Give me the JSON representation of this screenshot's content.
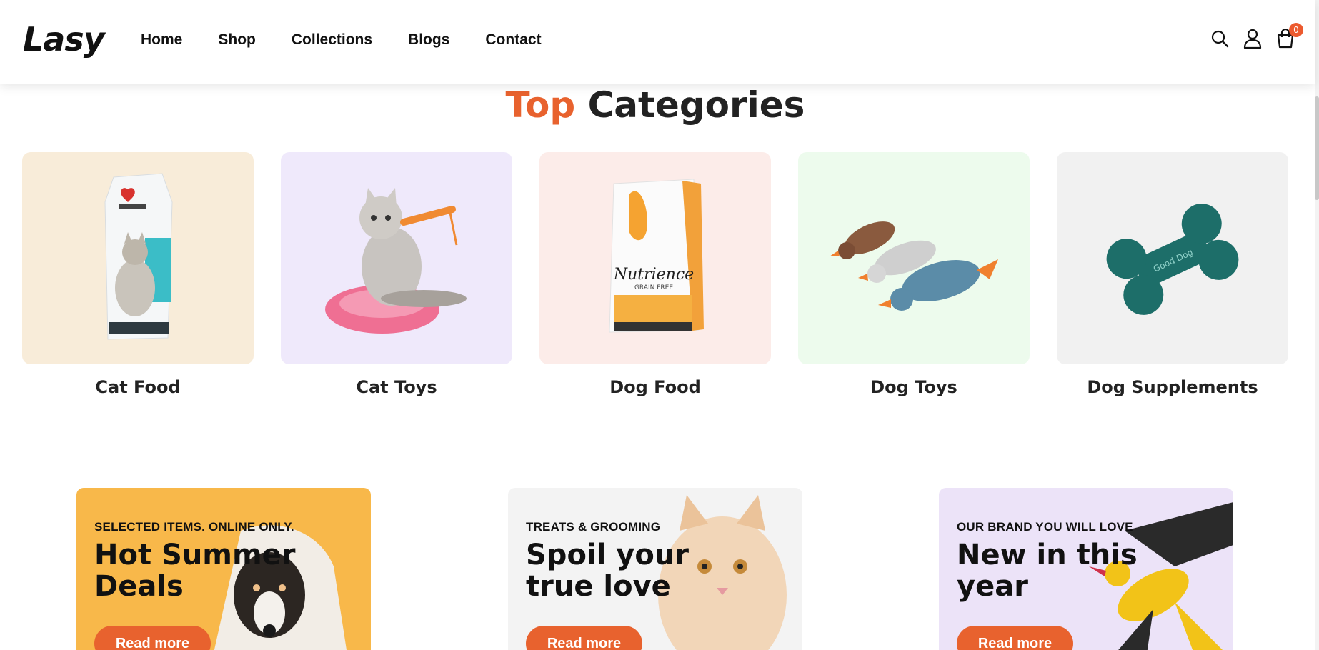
{
  "header": {
    "logo": "Lasy",
    "nav": [
      "Home",
      "Shop",
      "Collections",
      "Blogs",
      "Contact"
    ],
    "cart_count": "0",
    "icons": [
      "search-icon",
      "user-icon",
      "cart-icon"
    ]
  },
  "section": {
    "title_accent": "Top",
    "title_rest": "Categories"
  },
  "categories": [
    {
      "label": "Cat Food",
      "bg": "#f8ecd9"
    },
    {
      "label": "Cat Toys",
      "bg": "#efe9fb"
    },
    {
      "label": "Dog Food",
      "bg": "#fcece9"
    },
    {
      "label": "Dog Toys",
      "bg": "#edfbed"
    },
    {
      "label": "Dog Supplements",
      "bg": "#f1f1f1"
    }
  ],
  "promos": [
    {
      "eyebrow": "SELECTED ITEMS. ONLINE ONLY.",
      "headline": "Hot Summer Deals",
      "button": "Read more",
      "bg": "#f8b84a"
    },
    {
      "eyebrow": "TREATS & GROOMING",
      "headline": "Spoil your true love",
      "button": "Read more",
      "bg": "#f3f3f3"
    },
    {
      "eyebrow": "OUR BRAND YOU WILL LOVE",
      "headline": "New in this year",
      "button": "Read more",
      "bg": "#ece3f8"
    }
  ],
  "colors": {
    "accent": "#e8622e"
  }
}
